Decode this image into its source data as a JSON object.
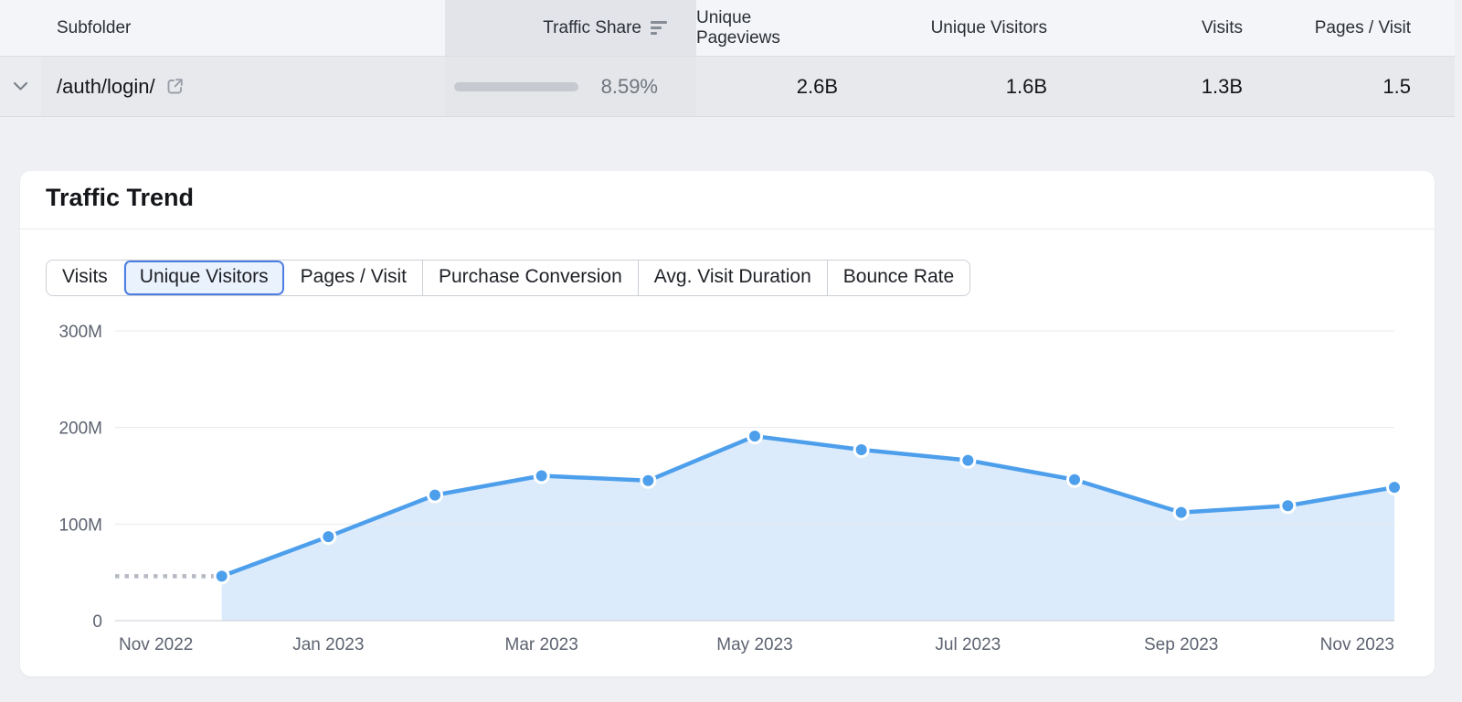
{
  "table": {
    "columns": [
      {
        "label": "Subfolder"
      },
      {
        "label": "Traffic Share",
        "sorted": true
      },
      {
        "label": "Unique Pageviews"
      },
      {
        "label": "Unique Visitors"
      },
      {
        "label": "Visits"
      },
      {
        "label": "Pages / Visit"
      }
    ],
    "row": {
      "subfolder": "/auth/login/",
      "traffic_share_pct": "8.59%",
      "traffic_share_fraction": 0.0859,
      "unique_pageviews": "2.6B",
      "unique_visitors": "1.6B",
      "visits": "1.3B",
      "pages_per_visit": "1.5"
    }
  },
  "card": {
    "title": "Traffic Trend",
    "tabs": [
      {
        "label": "Visits",
        "selected": false
      },
      {
        "label": "Unique Visitors",
        "selected": true
      },
      {
        "label": "Pages / Visit",
        "selected": false
      },
      {
        "label": "Purchase Conversion",
        "selected": false
      },
      {
        "label": "Avg. Visit Duration",
        "selected": false
      },
      {
        "label": "Bounce Rate",
        "selected": false
      }
    ]
  },
  "chart_data": {
    "type": "area",
    "title": "Traffic Trend",
    "series_name": "Unique Visitors",
    "unit": "millions",
    "x": [
      "Nov 2022",
      "Dec 2022",
      "Jan 2023",
      "Feb 2023",
      "Mar 2023",
      "Apr 2023",
      "May 2023",
      "Jun 2023",
      "Jul 2023",
      "Aug 2023",
      "Sep 2023",
      "Oct 2023",
      "Nov 2023"
    ],
    "values_millions": [
      46,
      46,
      87,
      130,
      150,
      145,
      191,
      177,
      166,
      146,
      112,
      119,
      138
    ],
    "dashed_until_index": 1,
    "ylim_millions": [
      0,
      300
    ],
    "ytick_values": [
      0,
      100,
      200,
      300
    ],
    "ytick_labels": [
      "0",
      "100M",
      "200M",
      "300M"
    ],
    "xtick_indices": [
      0,
      2,
      4,
      6,
      8,
      10,
      12
    ],
    "xtick_labels": [
      "Nov 2022",
      "Jan 2023",
      "Mar 2023",
      "May 2023",
      "Jul 2023",
      "Sep 2023",
      "Nov 2023"
    ],
    "grid": "horizontal",
    "legend": "none"
  },
  "colors": {
    "accent_blue": "#4d9fec",
    "area_fill": "#dcebfb",
    "dashed_gray": "#b5b9c2",
    "grid_line": "#e8eaee",
    "axis_line": "#c9ccd3",
    "axis_text": "#5d6370",
    "selected_tab_border": "#4c7de2",
    "selected_tab_bg": "#eaf2fd",
    "progress_track": "#c6c9cf"
  }
}
